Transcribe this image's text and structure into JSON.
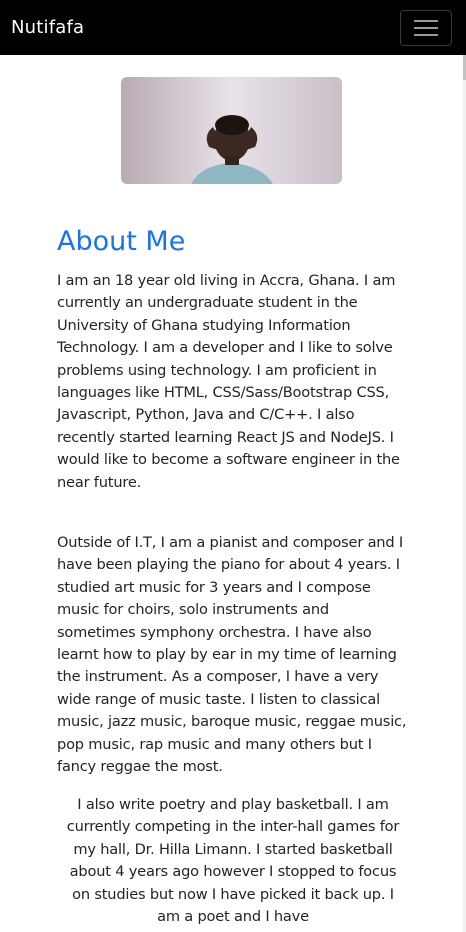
{
  "navbar": {
    "brand": "Nutifafa",
    "toggler_icon": "hamburger-icon"
  },
  "profile": {
    "photo_icon": "profile-photo"
  },
  "about": {
    "heading": "About Me",
    "paragraphs": [
      "I am an 18 year old living in Accra, Ghana. I am currently an undergraduate student in the University of Ghana studying Information Technology. I am a developer and I like to solve problems using technology. I am proficient in languages like HTML, CSS/Sass/Bootstrap CSS, Javascript, Python, Java and C/C++. I also recently started learning React JS and NodeJS. I would like to become a software engineer in the near future.",
      "Outside of I.T, I am a pianist and composer and I have been playing the piano for about 4 years. I studied art music for 3 years and I compose music for choirs, solo instruments and sometimes symphony orchestra. I have also learnt how to play by ear in my time of learning the instrument. As a composer, I have a very wide range of music taste. I listen to classical music, jazz music, baroque music, reggae music, pop music, rap music and many others but I fancy reggae the most.",
      "I also write poetry and play basketball. I am currently competing in the inter-hall games for my hall, Dr. Hilla Limann. I started basketball about 4 years ago however I stopped to focus on studies but now I have picked it back up. I am a poet and I have"
    ]
  },
  "colors": {
    "navbar_bg": "#000000",
    "heading": "#1a73e8",
    "text": "#212529"
  }
}
